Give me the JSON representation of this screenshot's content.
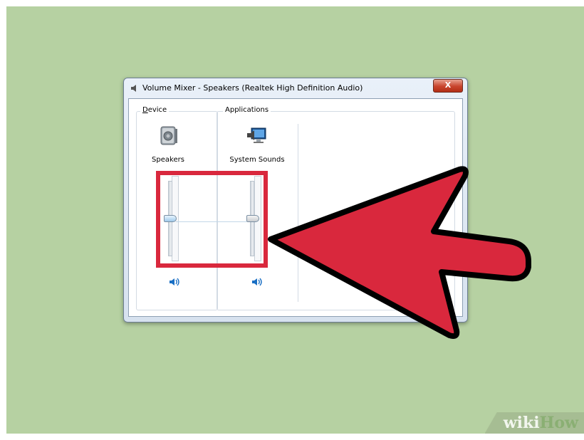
{
  "window": {
    "title": "Volume Mixer - Speakers (Realtek High Definition Audio)",
    "close_label": "X"
  },
  "device": {
    "group_label_accesskey": "D",
    "group_label_rest": "evice",
    "name": "Speakers",
    "icon": "speaker-device-icon",
    "volume_fraction": 0.5
  },
  "applications": {
    "group_label": "Applications",
    "items": [
      {
        "name": "System Sounds",
        "icon": "system-sounds-icon",
        "volume_fraction": 0.5
      }
    ]
  },
  "annotation": {
    "highlight_color": "#d9283d",
    "arrow_color": "#d9283d"
  },
  "watermark": {
    "part1": "wiki",
    "part2": "How"
  },
  "colors": {
    "background": "#b6d1a2",
    "accent": "#1a6fc4"
  }
}
